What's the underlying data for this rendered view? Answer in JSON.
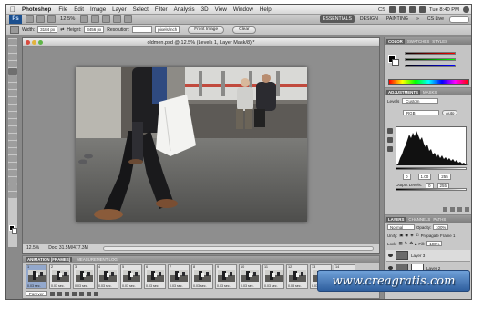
{
  "menubar": {
    "app": "Photoshop",
    "menus": [
      "File",
      "Edit",
      "Image",
      "Layer",
      "Select",
      "Filter",
      "Analysis",
      "3D",
      "View",
      "Window",
      "Help"
    ],
    "status_cs": "CS",
    "time": "Tue 8:40 PM"
  },
  "appbar": {
    "logo": "Ps",
    "zoom": "12.5%",
    "workspaces": [
      "ESSENTIALS",
      "DESIGN",
      "PAINTING"
    ],
    "more": "»",
    "cs_live": "CS Live"
  },
  "optbar": {
    "width_label": "Width:",
    "width_value": "3184 px",
    "height_label": "Height:",
    "height_value": "3456 px",
    "resolution_label": "Resolution:",
    "resolution_unit": "pixels/inch",
    "front_image": "Front Image",
    "clear": "Clear"
  },
  "document": {
    "title": "oldmen.psd @ 12.5% (Levels 1, Layer Mask/8) *",
    "zoom": "12.5%",
    "doc_info": "Doc: 31.5M/477.3M"
  },
  "panels": {
    "color_tabs": [
      "COLOR",
      "SWATCHES",
      "STYLES"
    ],
    "adj_tabs": [
      "ADJUSTMENTS",
      "MASKS"
    ],
    "levels_label": "Levels",
    "levels_preset": "Custom",
    "channel": "RGB",
    "auto": "Auto",
    "input_black": "0",
    "input_gamma": "1.00",
    "input_white": "255",
    "output_label": "Output Levels:",
    "output_black": "0",
    "output_white": "255",
    "layers_tabs": [
      "LAYERS",
      "CHANNELS",
      "PATHS"
    ],
    "blend_mode": "Normal",
    "opacity_label": "Opacity:",
    "opacity": "100%",
    "unify_label": "Unify:",
    "propagate": "Propagate Frame 1",
    "lock_label": "Lock:",
    "fill_label": "Fill:",
    "fill": "100%",
    "layers": [
      "Layer 3",
      "Layer 2"
    ]
  },
  "animation": {
    "tabs": [
      "ANIMATION (FRAMES)",
      "MEASUREMENT LOG"
    ],
    "frame_delay": "0.03 sec.",
    "frame_numbers": [
      "1",
      "2",
      "3",
      "4",
      "5",
      "6",
      "7",
      "8",
      "9",
      "10",
      "11",
      "12",
      "13",
      "14"
    ],
    "loop": "Forever"
  },
  "watermark": "www.creagratis.com"
}
